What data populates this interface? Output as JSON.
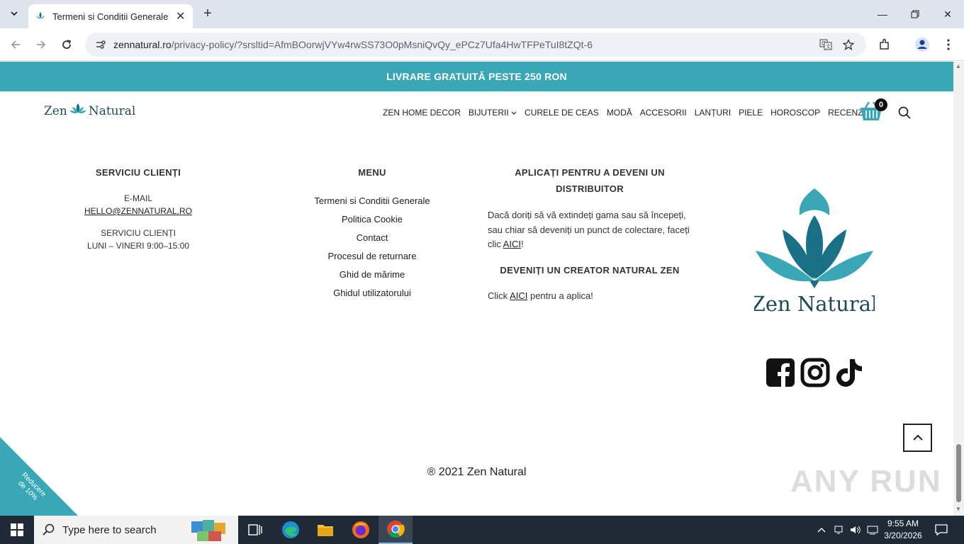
{
  "browser": {
    "tab_title": "Termeni si Conditii Generale - Z",
    "url_host": "zennatural.ro",
    "url_path": "/privacy-policy/?srsltid=AfmBOorwjVYw4rwSS73O0pMsniQvQy_ePCz7Ufa4HwTFPeTuI8tZQt-6"
  },
  "promo": {
    "text": "LIVRARE GRATUITĂ PESTE 250 RON"
  },
  "logo": {
    "text_left": "Zen",
    "text_right": "Natural",
    "big_text": "Zen Natural"
  },
  "nav": {
    "items": [
      "ZEN HOME DECOR",
      "BIJUTERII",
      "CURELE DE CEAS",
      "MODĂ",
      "ACCESORII",
      "LANȚURI",
      "PIELE",
      "HOROSCOP",
      "RECENZIILE"
    ],
    "cart_count": "0"
  },
  "footer": {
    "service": {
      "title": "SERVICIU CLIENȚI",
      "email_label": "E-MAIL",
      "email": "HELLO@ZENNATURAL.RO",
      "hours_label": "SERVICIU CLIENȚI",
      "hours": "LUNI – VINERI 9:00–15:00"
    },
    "menu": {
      "title": "MENU",
      "items": [
        "Termeni si Conditii Generale",
        "Politica Cookie",
        "Contact",
        "Procesul de returnare",
        "Ghid de mărime",
        "Ghidul utilizatorului"
      ]
    },
    "distributor": {
      "title_line1": "APLICAȚI PENTRU A DEVENI UN",
      "title_line2": "DISTRIBUITOR",
      "text_line1": "Dacă doriți să vă extindeți gama sau să începeți,",
      "text_line2": "sau chiar să deveniți un punct de colectare, faceți",
      "text_line3_pre": "clic ",
      "link": "AICI",
      "text_line3_post": "!",
      "creator_title": "DEVENIȚI UN CREATOR NATURAL ZEN",
      "creator_pre": "Click ",
      "creator_link": "AICI",
      "creator_post": " pentru a aplica!"
    },
    "copyright": "® 2021 Zen Natural"
  },
  "discount": {
    "line1": "Reducere",
    "line2": "de 10%"
  },
  "watermark": "ANY RUN",
  "taskbar": {
    "search_placeholder": "Type here to search",
    "time": "9:55 AM",
    "date": "3/20/2026"
  },
  "colors": {
    "teal": "#3aa7b6",
    "dark_teal": "#1a7185",
    "taskbar": "#1f2a36"
  }
}
